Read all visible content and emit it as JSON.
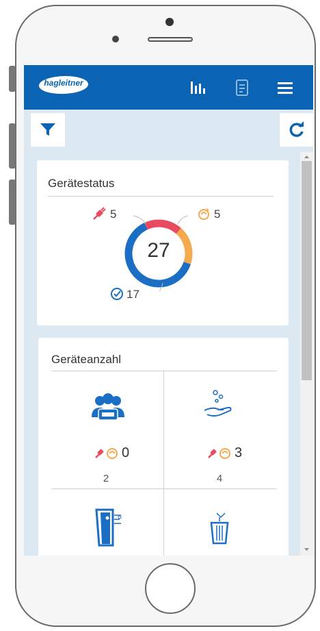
{
  "app": {
    "brand": "hagleitner",
    "nav_icons": [
      "bar-chart-icon",
      "report-icon",
      "menu-icon"
    ],
    "toolbar_icons": [
      "filter-icon",
      "refresh-icon"
    ],
    "colors": {
      "header": "#0b63b3",
      "accent": "#1a6fc4",
      "error": "#e84a5f",
      "warning": "#f5a94e",
      "ok": "#1a6fc4"
    }
  },
  "device_status": {
    "title": "Gerätestatus",
    "total": "27",
    "error_count": "5",
    "warning_count": "5",
    "ok_count": "17"
  },
  "device_count": {
    "title": "Geräteanzahl",
    "cells": [
      {
        "icon": "users-device-icon",
        "alerts": "0",
        "count": "2"
      },
      {
        "icon": "hand-soap-icon",
        "alerts": "3",
        "count": "4"
      },
      {
        "icon": "paper-dispenser-icon",
        "alerts": "",
        "count": ""
      },
      {
        "icon": "waste-bin-icon",
        "alerts": "",
        "count": ""
      }
    ]
  },
  "chart_data": {
    "type": "pie",
    "categories": [
      "Fehler",
      "Warnung",
      "OK"
    ],
    "values": [
      5,
      5,
      17
    ],
    "colors": [
      "#e84a5f",
      "#f5a94e",
      "#1a6fc4"
    ]
  }
}
